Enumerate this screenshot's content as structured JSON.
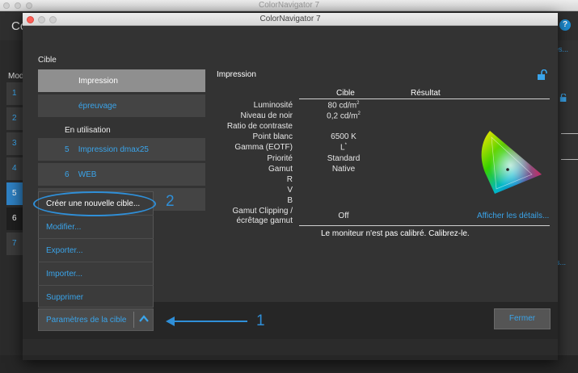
{
  "background_window": {
    "title": "ColorNavigator 7",
    "cutoff_title": "Colo",
    "mode_label": "Mod",
    "modes": [
      "1",
      "2",
      "3",
      "4",
      "5",
      "6",
      "7"
    ],
    "selected_mode": "5",
    "right_links": [
      "es...",
      "ls..."
    ],
    "help_label": "?"
  },
  "dialog": {
    "title": "ColorNavigator 7",
    "section_title": "Cible",
    "targets": {
      "selected": "Impression",
      "proof": "épreuvage",
      "in_use_label": "En utilisation",
      "in_use": [
        {
          "num": "5",
          "name": "Impression dmax25"
        },
        {
          "num": "6",
          "name": "WEB"
        }
      ]
    },
    "context_menu": [
      "Créer une nouvelle cible...",
      "Modifier...",
      "Exporter...",
      "Importer...",
      "Supprimer"
    ],
    "params_button": "Paramètres de la cible",
    "callout_1": "1",
    "callout_2": "2",
    "detail": {
      "title": "Impression",
      "col_target": "Cible",
      "col_result": "Résultat",
      "rows": {
        "luminance": {
          "label": "Luminosité",
          "value": "80 cd/m",
          "sup": "2"
        },
        "black": {
          "label": "Niveau de noir",
          "value": "0,2 cd/m",
          "sup": "2"
        },
        "contrast": {
          "label": "Ratio de contraste",
          "value": ""
        },
        "white": {
          "label": "Point blanc",
          "value": "6500 K"
        },
        "gamma": {
          "label": "Gamma (EOTF)",
          "value": "L",
          "sup": "*"
        },
        "priority": {
          "label": "Priorité",
          "value": "Standard"
        },
        "gamut": {
          "label": "Gamut",
          "value": "Native"
        },
        "r": {
          "label": "R",
          "value": ""
        },
        "g": {
          "label": "V",
          "value": ""
        },
        "b": {
          "label": "B",
          "value": ""
        },
        "clipping_1": {
          "label": "Gamut Clipping /",
          "value": ""
        },
        "clipping_2": {
          "label": "écrêtage gamut",
          "value": "Off"
        }
      },
      "details_link": "Afficher les détails...",
      "status": "Le moniteur n'est pas calibré. Calibrez-le."
    },
    "close_button": "Fermer"
  }
}
